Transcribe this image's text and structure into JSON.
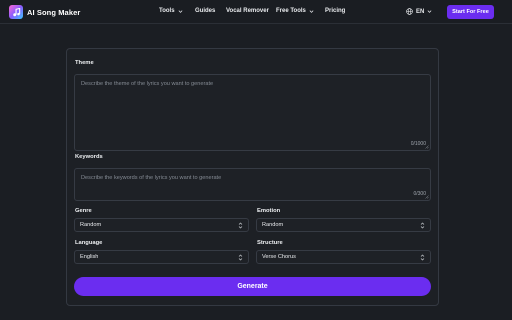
{
  "brand": {
    "name": "AI Song Maker"
  },
  "nav": {
    "items": [
      {
        "label": "Tools",
        "dropdown": true
      },
      {
        "label": "Guides",
        "dropdown": false
      },
      {
        "label": "Vocal Remover",
        "dropdown": false
      },
      {
        "label": "Free Tools",
        "dropdown": true
      },
      {
        "label": "Pricing",
        "dropdown": false
      }
    ],
    "language": "EN",
    "cta_label": "Start For Free"
  },
  "form": {
    "theme": {
      "label": "Theme",
      "placeholder": "Describe the theme of the lyrics you want to generate",
      "counter": "0/1000"
    },
    "keywords": {
      "label": "Keywords",
      "placeholder": "Describe the keywords of the lyrics you want to generate",
      "counter": "0/300"
    },
    "genre": {
      "label": "Genre",
      "value": "Random"
    },
    "emotion": {
      "label": "Emotion",
      "value": "Random"
    },
    "language": {
      "label": "Language",
      "value": "English"
    },
    "structure": {
      "label": "Structure",
      "value": "Verse Chorus"
    },
    "generate_label": "Generate"
  },
  "colors": {
    "background": "#1b1e23",
    "accent": "#6b2df0",
    "border": "#363b44"
  }
}
